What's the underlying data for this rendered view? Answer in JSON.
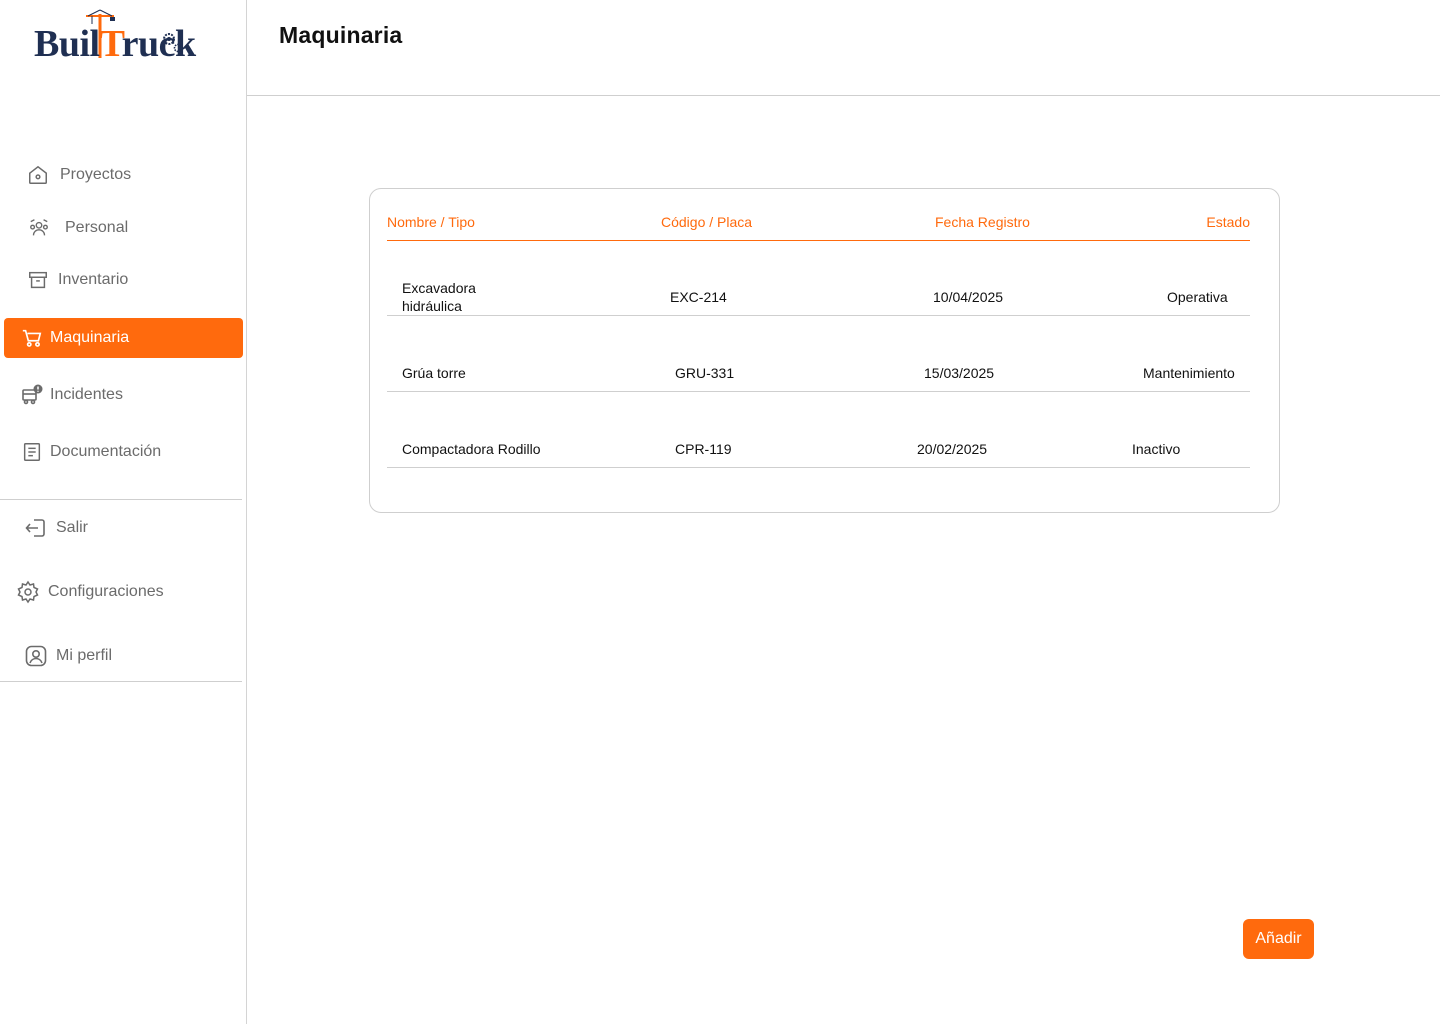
{
  "brand": {
    "logo_text": "BuilTruck",
    "accent_color": "#ff6a0d",
    "logo_color": "#1f2f52"
  },
  "sidebar": {
    "items": [
      {
        "label": "Proyectos",
        "icon": "home-icon"
      },
      {
        "label": "Personal",
        "icon": "people-icon"
      },
      {
        "label": "Inventario",
        "icon": "archive-box-icon"
      },
      {
        "label": "Maquinaria",
        "icon": "cart-icon",
        "active": true
      },
      {
        "label": "Incidentes",
        "icon": "truck-alert-icon"
      },
      {
        "label": "Documentación",
        "icon": "document-icon"
      }
    ],
    "bottom_items": [
      {
        "label": "Salir",
        "icon": "logout-icon"
      },
      {
        "label": "Configuraciones",
        "icon": "gear-icon"
      },
      {
        "label": "Mi perfil",
        "icon": "user-icon"
      }
    ]
  },
  "header": {
    "title": "Maquinaria"
  },
  "table": {
    "columns": [
      "Nombre / Tipo",
      "Código / Placa",
      "Fecha Registro",
      "Estado"
    ],
    "rows": [
      {
        "name_line1": "Excavadora",
        "name_line2": "hidráulica",
        "code": "EXC-214",
        "date": "10/04/2025",
        "status": "Operativa"
      },
      {
        "name_line1": "Grúa torre",
        "name_line2": "",
        "code": "GRU-331",
        "date": "15/03/2025",
        "status": "Mantenimiento"
      },
      {
        "name_line1": "Compactadora Rodillo",
        "name_line2": "",
        "code": "CPR-119",
        "date": "20/02/2025",
        "status": "Inactivo"
      }
    ]
  },
  "actions": {
    "add_label": "Añadir"
  }
}
